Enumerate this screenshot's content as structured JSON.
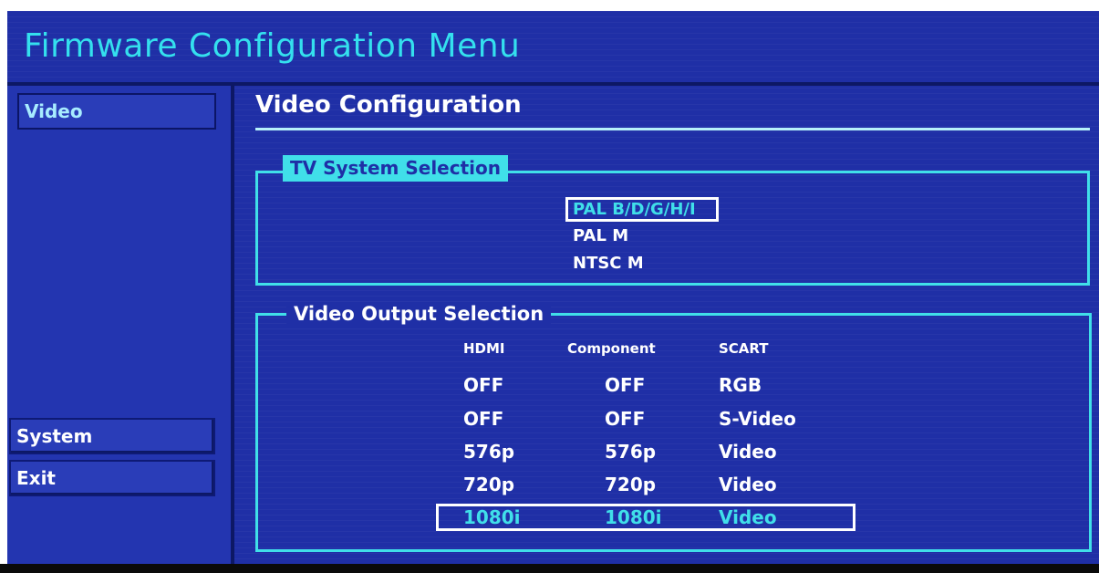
{
  "app": {
    "title": "Firmware Configuration Menu"
  },
  "sidebar": {
    "items": [
      {
        "label": "Video",
        "active": true
      },
      {
        "label": "System",
        "active": false
      },
      {
        "label": "Exit",
        "active": false
      }
    ]
  },
  "panel": {
    "title": "Video Configuration"
  },
  "tv_system": {
    "legend": "TV System Selection",
    "options": [
      {
        "label": "PAL B/D/G/H/I",
        "selected": true
      },
      {
        "label": "PAL M",
        "selected": false
      },
      {
        "label": "NTSC M",
        "selected": false
      }
    ]
  },
  "video_output": {
    "legend": "Video Output Selection",
    "headers": [
      "HDMI",
      "Component",
      "SCART"
    ],
    "rows": [
      {
        "hdmi": "OFF",
        "component": "OFF",
        "scart": "RGB",
        "selected": false
      },
      {
        "hdmi": "OFF",
        "component": "OFF",
        "scart": "S-Video",
        "selected": false
      },
      {
        "hdmi": "576p",
        "component": "576p",
        "scart": "Video",
        "selected": false
      },
      {
        "hdmi": "720p",
        "component": "720p",
        "scart": "Video",
        "selected": false
      },
      {
        "hdmi": "1080i",
        "component": "1080i",
        "scart": "Video",
        "selected": true
      }
    ]
  },
  "colors": {
    "background": "#1f2fa6",
    "accent": "#40dfe9",
    "title_text": "#34e0ee",
    "text": "#ffffff",
    "highlight_border": "#ffffff"
  }
}
